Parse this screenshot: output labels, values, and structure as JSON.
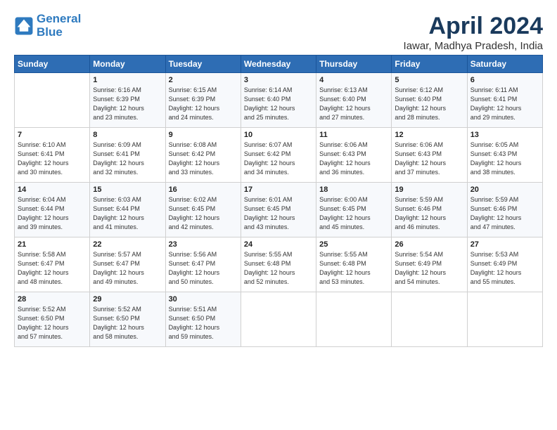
{
  "logo": {
    "line1": "General",
    "line2": "Blue"
  },
  "title": "April 2024",
  "subtitle": "Iawar, Madhya Pradesh, India",
  "days_header": [
    "Sunday",
    "Monday",
    "Tuesday",
    "Wednesday",
    "Thursday",
    "Friday",
    "Saturday"
  ],
  "weeks": [
    [
      {
        "day": "",
        "info": ""
      },
      {
        "day": "1",
        "info": "Sunrise: 6:16 AM\nSunset: 6:39 PM\nDaylight: 12 hours\nand 23 minutes."
      },
      {
        "day": "2",
        "info": "Sunrise: 6:15 AM\nSunset: 6:39 PM\nDaylight: 12 hours\nand 24 minutes."
      },
      {
        "day": "3",
        "info": "Sunrise: 6:14 AM\nSunset: 6:40 PM\nDaylight: 12 hours\nand 25 minutes."
      },
      {
        "day": "4",
        "info": "Sunrise: 6:13 AM\nSunset: 6:40 PM\nDaylight: 12 hours\nand 27 minutes."
      },
      {
        "day": "5",
        "info": "Sunrise: 6:12 AM\nSunset: 6:40 PM\nDaylight: 12 hours\nand 28 minutes."
      },
      {
        "day": "6",
        "info": "Sunrise: 6:11 AM\nSunset: 6:41 PM\nDaylight: 12 hours\nand 29 minutes."
      }
    ],
    [
      {
        "day": "7",
        "info": "Sunrise: 6:10 AM\nSunset: 6:41 PM\nDaylight: 12 hours\nand 30 minutes."
      },
      {
        "day": "8",
        "info": "Sunrise: 6:09 AM\nSunset: 6:41 PM\nDaylight: 12 hours\nand 32 minutes."
      },
      {
        "day": "9",
        "info": "Sunrise: 6:08 AM\nSunset: 6:42 PM\nDaylight: 12 hours\nand 33 minutes."
      },
      {
        "day": "10",
        "info": "Sunrise: 6:07 AM\nSunset: 6:42 PM\nDaylight: 12 hours\nand 34 minutes."
      },
      {
        "day": "11",
        "info": "Sunrise: 6:06 AM\nSunset: 6:43 PM\nDaylight: 12 hours\nand 36 minutes."
      },
      {
        "day": "12",
        "info": "Sunrise: 6:06 AM\nSunset: 6:43 PM\nDaylight: 12 hours\nand 37 minutes."
      },
      {
        "day": "13",
        "info": "Sunrise: 6:05 AM\nSunset: 6:43 PM\nDaylight: 12 hours\nand 38 minutes."
      }
    ],
    [
      {
        "day": "14",
        "info": "Sunrise: 6:04 AM\nSunset: 6:44 PM\nDaylight: 12 hours\nand 39 minutes."
      },
      {
        "day": "15",
        "info": "Sunrise: 6:03 AM\nSunset: 6:44 PM\nDaylight: 12 hours\nand 41 minutes."
      },
      {
        "day": "16",
        "info": "Sunrise: 6:02 AM\nSunset: 6:45 PM\nDaylight: 12 hours\nand 42 minutes."
      },
      {
        "day": "17",
        "info": "Sunrise: 6:01 AM\nSunset: 6:45 PM\nDaylight: 12 hours\nand 43 minutes."
      },
      {
        "day": "18",
        "info": "Sunrise: 6:00 AM\nSunset: 6:45 PM\nDaylight: 12 hours\nand 45 minutes."
      },
      {
        "day": "19",
        "info": "Sunrise: 5:59 AM\nSunset: 6:46 PM\nDaylight: 12 hours\nand 46 minutes."
      },
      {
        "day": "20",
        "info": "Sunrise: 5:59 AM\nSunset: 6:46 PM\nDaylight: 12 hours\nand 47 minutes."
      }
    ],
    [
      {
        "day": "21",
        "info": "Sunrise: 5:58 AM\nSunset: 6:47 PM\nDaylight: 12 hours\nand 48 minutes."
      },
      {
        "day": "22",
        "info": "Sunrise: 5:57 AM\nSunset: 6:47 PM\nDaylight: 12 hours\nand 49 minutes."
      },
      {
        "day": "23",
        "info": "Sunrise: 5:56 AM\nSunset: 6:47 PM\nDaylight: 12 hours\nand 50 minutes."
      },
      {
        "day": "24",
        "info": "Sunrise: 5:55 AM\nSunset: 6:48 PM\nDaylight: 12 hours\nand 52 minutes."
      },
      {
        "day": "25",
        "info": "Sunrise: 5:55 AM\nSunset: 6:48 PM\nDaylight: 12 hours\nand 53 minutes."
      },
      {
        "day": "26",
        "info": "Sunrise: 5:54 AM\nSunset: 6:49 PM\nDaylight: 12 hours\nand 54 minutes."
      },
      {
        "day": "27",
        "info": "Sunrise: 5:53 AM\nSunset: 6:49 PM\nDaylight: 12 hours\nand 55 minutes."
      }
    ],
    [
      {
        "day": "28",
        "info": "Sunrise: 5:52 AM\nSunset: 6:50 PM\nDaylight: 12 hours\nand 57 minutes."
      },
      {
        "day": "29",
        "info": "Sunrise: 5:52 AM\nSunset: 6:50 PM\nDaylight: 12 hours\nand 58 minutes."
      },
      {
        "day": "30",
        "info": "Sunrise: 5:51 AM\nSunset: 6:50 PM\nDaylight: 12 hours\nand 59 minutes."
      },
      {
        "day": "",
        "info": ""
      },
      {
        "day": "",
        "info": ""
      },
      {
        "day": "",
        "info": ""
      },
      {
        "day": "",
        "info": ""
      }
    ]
  ]
}
